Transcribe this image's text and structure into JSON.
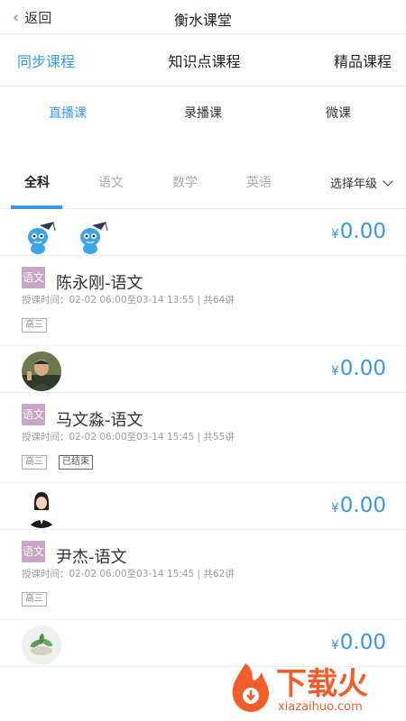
{
  "header": {
    "back_label": "返回",
    "title": "衡水课堂"
  },
  "main_tabs": [
    {
      "label": "同步课程",
      "active": true
    },
    {
      "label": "知识点课程",
      "active": false
    },
    {
      "label": "精品课程",
      "active": false
    }
  ],
  "sub_tabs": [
    {
      "label": "直播课",
      "active": true
    },
    {
      "label": "录播课",
      "active": false
    },
    {
      "label": "微课",
      "active": false
    }
  ],
  "subject_tabs": [
    {
      "label": "全科",
      "active": true
    },
    {
      "label": "语文",
      "active": false
    },
    {
      "label": "数学",
      "active": false
    },
    {
      "label": "英语",
      "active": false
    }
  ],
  "grade_select": {
    "label": "选择年级"
  },
  "courses": [
    {
      "avatar_icon": "cartoon-mascot-icon",
      "price_symbol": "¥",
      "price": "0.00",
      "subject": "语文",
      "name": "陈永刚-语文",
      "meta": "授课时间：02-02 06:00至03-14 13:55   |   共64讲",
      "tags": [
        "高三"
      ]
    },
    {
      "avatar_icon": "teacher-photo",
      "price_symbol": "¥",
      "price": "0.00",
      "subject": "语文",
      "name": "马文淼-语文",
      "meta": "授课时间：02-02 06:00至03-14 15:45   |   共55讲",
      "tags": [
        "高三",
        "已结束"
      ]
    },
    {
      "avatar_icon": "teacher-photo",
      "price_symbol": "¥",
      "price": "0.00",
      "subject": "语文",
      "name": "尹杰-语文",
      "meta": "授课时间：02-02 06:00至03-14 15:45   |   共62讲",
      "tags": [
        "高三"
      ]
    },
    {
      "avatar_icon": "plant-photo",
      "price_symbol": "¥",
      "price": "0.00"
    }
  ],
  "watermark": {
    "brand": "下载火",
    "domain": "xiazaihuo.com"
  },
  "colors": {
    "accent": "#3a97e8",
    "subject_badge": "#c9a6c6",
    "watermark": "#f25d2a"
  }
}
